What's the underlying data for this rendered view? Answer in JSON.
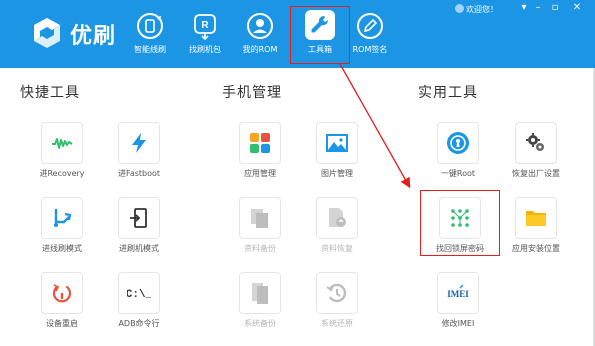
{
  "app": {
    "name": "优刷"
  },
  "header": {
    "welcome": "欢迎您！",
    "nav": [
      {
        "label": "智能线刷",
        "icon": "refresh-phone-icon"
      },
      {
        "label": "找刷机包",
        "icon": "rom-search-icon"
      },
      {
        "label": "我的ROM",
        "icon": "user-icon"
      },
      {
        "label": "工具箱",
        "icon": "wrench-icon"
      },
      {
        "label": "ROM签名",
        "icon": "pen-icon"
      }
    ]
  },
  "sections": {
    "quick_tools": "快捷工具",
    "phone_management": "手机管理",
    "practical_tools": "实用工具"
  },
  "quick_tools": [
    {
      "label": "进Recovery",
      "icon": "recovery-icon",
      "color": "#2fbf6e"
    },
    {
      "label": "进Fastboot",
      "icon": "lightning-icon",
      "color": "#1b95e4"
    },
    {
      "label": "进线刷模式",
      "icon": "usb-icon",
      "color": "#1b95e4"
    },
    {
      "label": "进刷机模式",
      "icon": "phone-enter-icon",
      "color": "#333333"
    },
    {
      "label": "设备重启",
      "icon": "restart-icon",
      "color": "#e8533f"
    },
    {
      "label": "ADB命令行",
      "icon": "terminal-icon",
      "color": "#333333"
    }
  ],
  "phone_management": [
    {
      "label": "应用管理",
      "icon": "apps-icon",
      "enabled": true
    },
    {
      "label": "图片管理",
      "icon": "image-icon",
      "enabled": true
    },
    {
      "label": "资料备份",
      "icon": "backup-icon",
      "enabled": false
    },
    {
      "label": "资料恢复",
      "icon": "restore-icon",
      "enabled": false
    },
    {
      "label": "系统备份",
      "icon": "system-backup-icon",
      "enabled": false
    },
    {
      "label": "系统还原",
      "icon": "system-restore-icon",
      "enabled": false
    }
  ],
  "practical_tools": [
    {
      "label": "一键Root",
      "icon": "keyhole-icon"
    },
    {
      "label": "恢复出厂设置",
      "icon": "gears-icon"
    },
    {
      "label": "找回锁屏密码",
      "icon": "pattern-lock-icon"
    },
    {
      "label": "应用安装位置",
      "icon": "folder-icon"
    },
    {
      "label": "修改IMEI",
      "icon": "imei-icon"
    }
  ],
  "colors": {
    "header": "#1b95e4",
    "accent": "#1b95e4",
    "highlight": "#e02020"
  }
}
